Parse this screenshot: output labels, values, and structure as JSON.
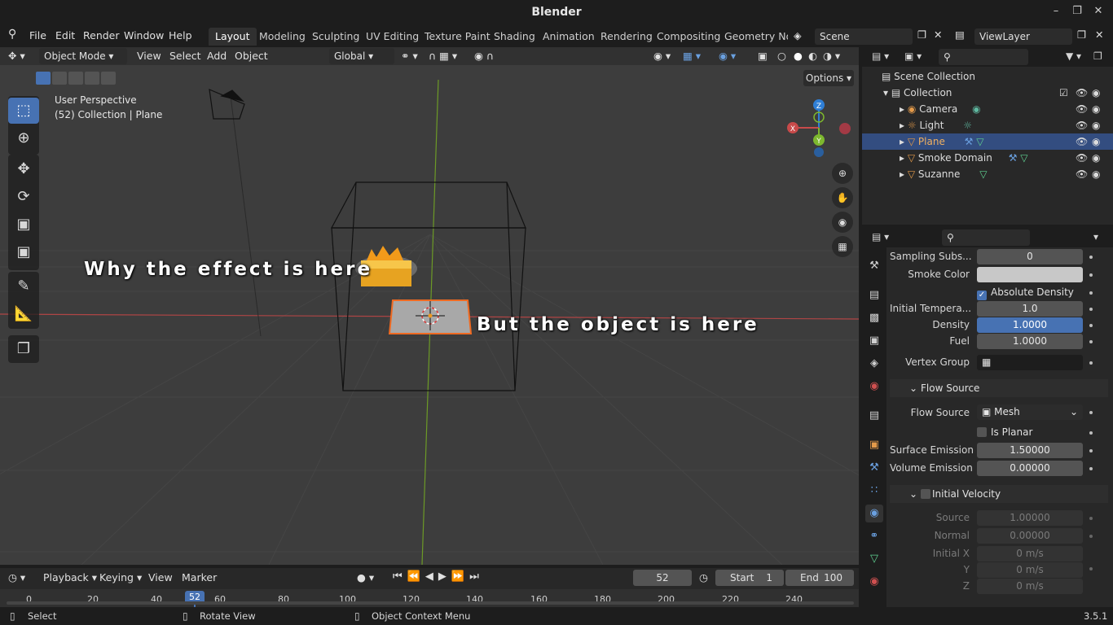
{
  "window": {
    "title": "Blender"
  },
  "menus": [
    "File",
    "Edit",
    "Render",
    "Window",
    "Help"
  ],
  "workspaces": [
    "Layout",
    "Modeling",
    "Sculpting",
    "UV Editing",
    "Texture Paint",
    "Shading",
    "Animation",
    "Rendering",
    "Compositing",
    "Geometry Noc"
  ],
  "scene": {
    "name": "Scene",
    "view_layer": "ViewLayer"
  },
  "viewport": {
    "mode": "Object Mode",
    "menu": [
      "View",
      "Select",
      "Add",
      "Object"
    ],
    "transform": "Global",
    "options": "Options",
    "info_line1": "User Perspective",
    "info_line2": "(52) Collection | Plane",
    "annotation_effect": "Why the effect is here",
    "annotation_object": "But the object is here",
    "gizmo": {
      "x": "X",
      "y": "Y",
      "z": "Z"
    }
  },
  "outliner": {
    "root": "Scene Collection",
    "collection": "Collection",
    "items": [
      "Camera",
      "Light",
      "Plane",
      "Smoke Domain",
      "Suzanne"
    ],
    "selected": "Plane"
  },
  "properties": {
    "sampling_label": "Sampling Subs...",
    "sampling_value": "0",
    "smoke_color_label": "Smoke Color",
    "smoke_color": "#c8c8c8",
    "absolute_density": "Absolute Density",
    "initial_temp_label": "Initial Tempera...",
    "initial_temp_value": "1.0",
    "density_label": "Density",
    "density_value": "1.0000",
    "fuel_label": "Fuel",
    "fuel_value": "1.0000",
    "vertex_group_label": "Vertex Group",
    "flow_source_panel": "Flow Source",
    "flow_source_label": "Flow Source",
    "flow_source_value": "Mesh",
    "is_planar": "Is Planar",
    "surface_emission_label": "Surface Emission",
    "surface_emission_value": "1.50000",
    "volume_emission_label": "Volume Emission",
    "volume_emission_value": "0.00000",
    "initial_velocity_panel": "Initial Velocity",
    "source_label": "Source",
    "source_value": "1.00000",
    "normal_label": "Normal",
    "normal_value": "0.00000",
    "initial_x_label": "Initial X",
    "initial_x_value": "0 m/s",
    "y_label": "Y",
    "y_value": "0 m/s",
    "z_label": "Z",
    "z_value": "0 m/s"
  },
  "timeline": {
    "menus": [
      "Playback",
      "Keying",
      "View",
      "Marker"
    ],
    "current_frame": "52",
    "start_label": "Start",
    "start_value": "1",
    "end_label": "End",
    "end_value": "100",
    "ticks": [
      "0",
      "20",
      "40",
      "60",
      "80",
      "100",
      "120",
      "140",
      "160",
      "180",
      "200",
      "220",
      "240"
    ]
  },
  "status": {
    "select": "Select",
    "rotate": "Rotate View",
    "context": "Object Context Menu",
    "version": "3.5.1"
  },
  "colors": {
    "accent": "#4772b3",
    "selected_row": "#334d80",
    "x_axis": "#c84a4a",
    "y_axis": "#7db82e",
    "z_axis": "#2f7fd6"
  }
}
